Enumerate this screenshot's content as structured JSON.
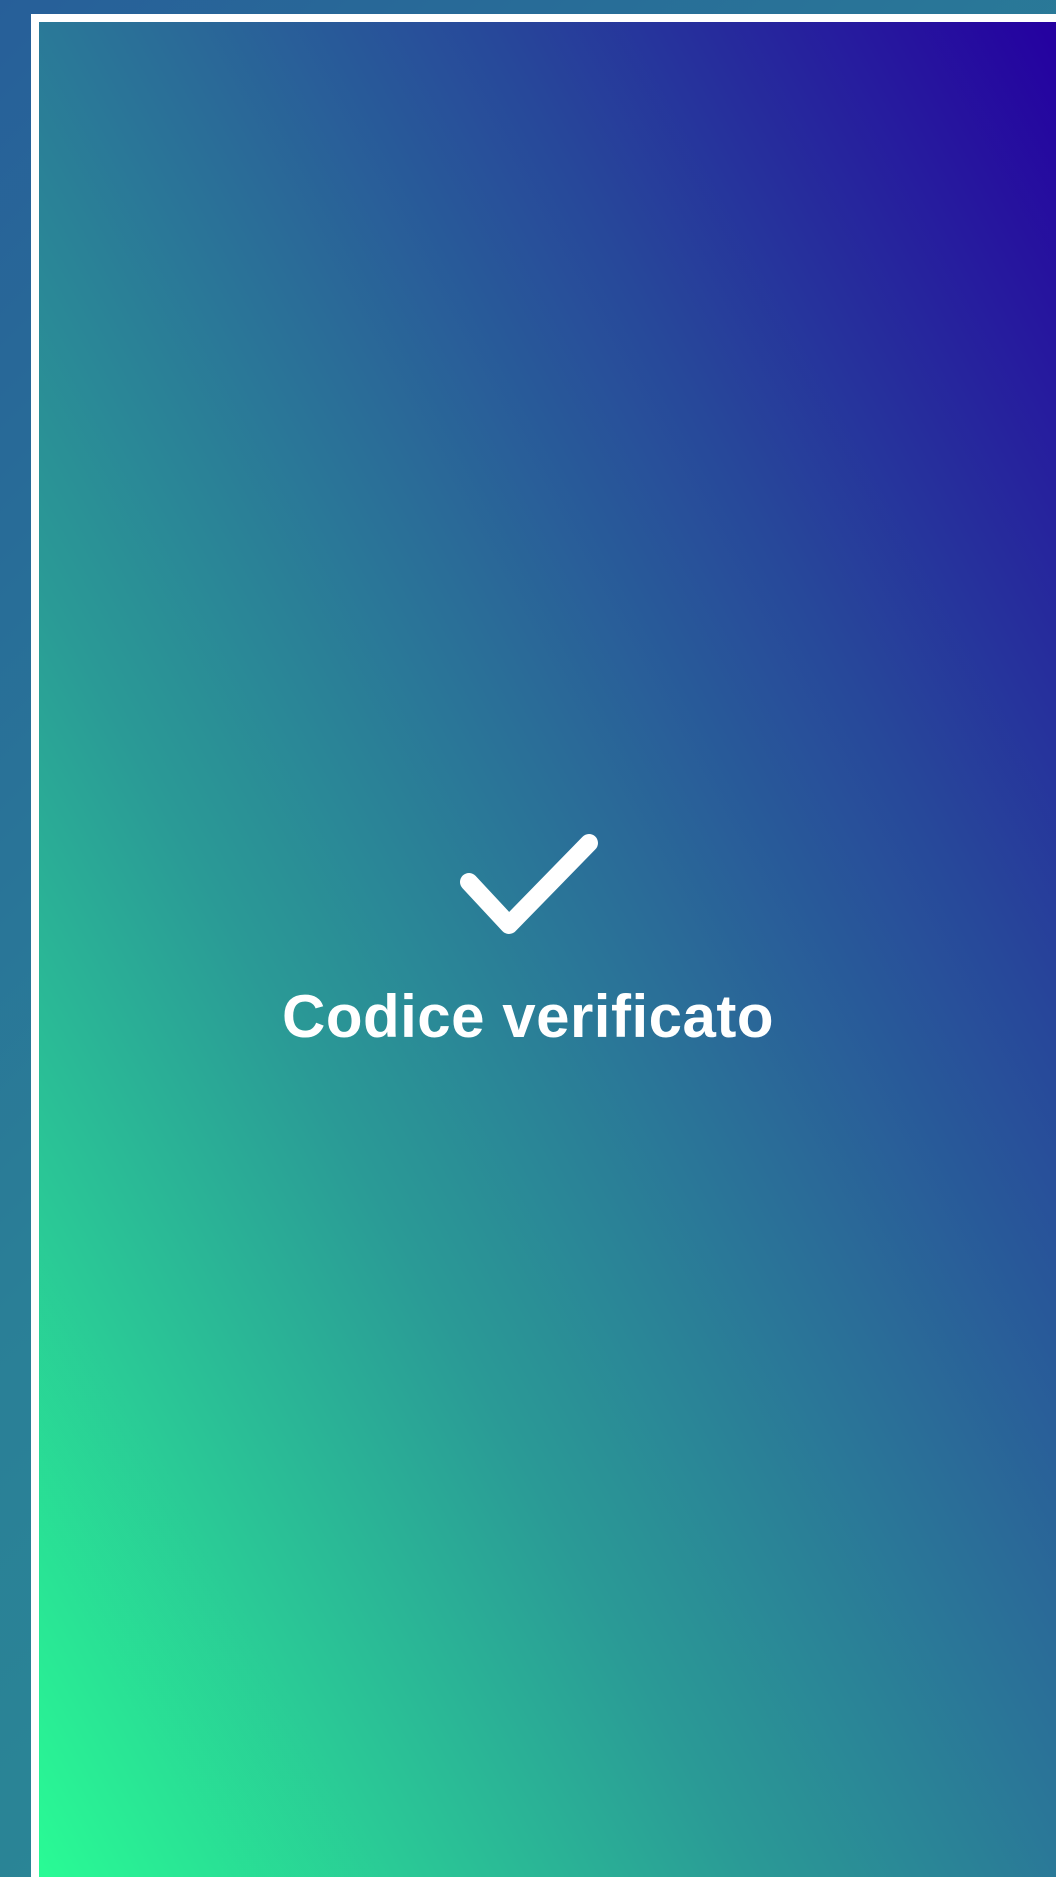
{
  "screen": {
    "status_title": "Codice verificato",
    "icon": "checkmark-icon",
    "colors": {
      "gradient_bottom_left": "#29fb95",
      "gradient_top_right": "#2500a0",
      "frame": "#ffffff",
      "text": "#ffffff"
    }
  }
}
